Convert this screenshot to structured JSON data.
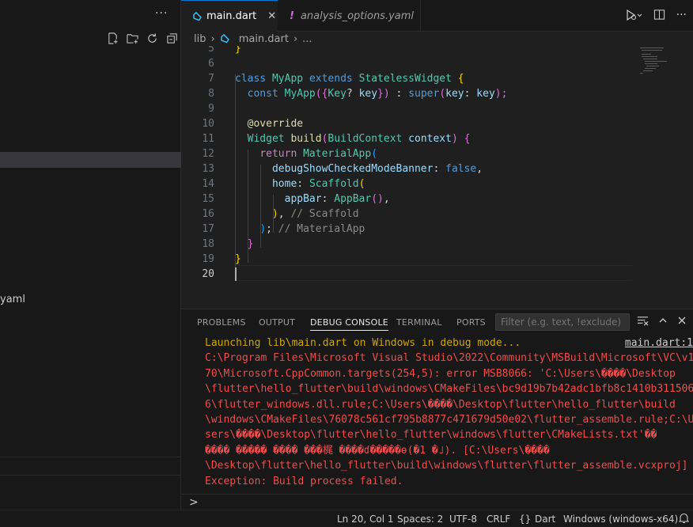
{
  "sidebar": {
    "more_label": "···",
    "visible_item": "yaml"
  },
  "tabs": [
    {
      "label": "main.dart",
      "close": "✕"
    },
    {
      "label": "analysis_options.yaml",
      "prefix": "!"
    }
  ],
  "breadcrumb": {
    "folder": "lib",
    "file": "main.dart",
    "rest": "..."
  },
  "editor": {
    "line_numbers": [
      "5",
      "6",
      "7",
      "8",
      "9",
      "10",
      "11",
      "12",
      "13",
      "14",
      "15",
      "16",
      "17",
      "18",
      "19",
      "20"
    ],
    "lines": {
      "l5": "}",
      "l7a": "class",
      "l7b": "MyApp",
      "l7c": "extends",
      "l7d": "StatelessWidget",
      "l7e": "{",
      "l8a": "const",
      "l8b": "MyApp",
      "l8c": "({",
      "l8d": "Key",
      "l8e": "?",
      "l8f": "key",
      "l8g": "})",
      "l8h": " : ",
      "l8i": "super",
      "l8j": "(",
      "l8k": "key",
      "l8l": ": ",
      "l8m": "key",
      "l8n": ");",
      "l10": "@override",
      "l11a": "Widget",
      "l11b": "build",
      "l11c": "(",
      "l11d": "BuildContext",
      "l11e": "context",
      "l11f": ")",
      "l11g": "{",
      "l12a": "return",
      "l12b": "MaterialApp",
      "l12c": "(",
      "l13a": "debugShowCheckedModeBanner",
      "l13b": ": ",
      "l13c": "false",
      "l13d": ",",
      "l14a": "home",
      "l14b": ": ",
      "l14c": "Scaffold",
      "l14d": "(",
      "l15a": "appBar",
      "l15b": ": ",
      "l15c": "AppBar",
      "l15d": "()",
      "l15e": ",",
      "l16a": ")",
      "l16b": ", ",
      "l16c": "// Scaffold",
      "l17a": ")",
      "l17b": "; ",
      "l17c": "// MaterialApp",
      "l18": "}",
      "l19": "}"
    }
  },
  "panel": {
    "tabs": [
      "PROBLEMS",
      "OUTPUT",
      "DEBUG CONSOLE",
      "TERMINAL",
      "PORTS"
    ],
    "active_tab": "DEBUG CONSOLE",
    "filter_placeholder": "Filter (e.g. text, !exclude)",
    "console": {
      "launch": "Launching lib\\main.dart on Windows in debug mode...",
      "link": "main.dart:1",
      "error_lines": [
        "C:\\Program Files\\Microsoft Visual Studio\\2022\\Community\\MSBuild\\Microsoft\\VC\\v1",
        "70\\Microsoft.CppCommon.targets(254,5): error MSB8066: 'C:\\Users\\����\\Desktop",
        "\\flutter\\hello_flutter\\build\\windows\\CMakeFiles\\bc9d19b7b42adc1bfb8c1410b311506",
        "6\\flutter_windows.dll.rule;C:\\Users\\����\\Desktop\\flutter\\hello_flutter\\build",
        "\\windows\\CMakeFiles\\76078c561cf795b8877c471679d50e02\\flutter_assemble.rule;C:\\U",
        "sers\\����\\Desktop\\flutter\\hello_flutter\\windows\\flutter\\CMakeLists.txt'��",
        "���� ����� ���� ���梶 ����ɗ�����ө(�1 �˩). [C:\\Users\\����",
        "\\Desktop\\flutter\\hello_flutter\\build\\windows\\flutter\\flutter_assemble.vcxproj]",
        "Exception: Build process failed."
      ]
    },
    "prompt": ">"
  },
  "statusbar": {
    "position": "Ln 20, Col 1",
    "spaces": "Spaces: 2",
    "encoding": "UTF-8",
    "eol": "CRLF",
    "language_braces": "{}",
    "language": "Dart",
    "device": "Windows (windows-x64)"
  },
  "colors": {
    "accent": "#0078d4",
    "error": "#f14c4c",
    "warning": "#cca700"
  }
}
